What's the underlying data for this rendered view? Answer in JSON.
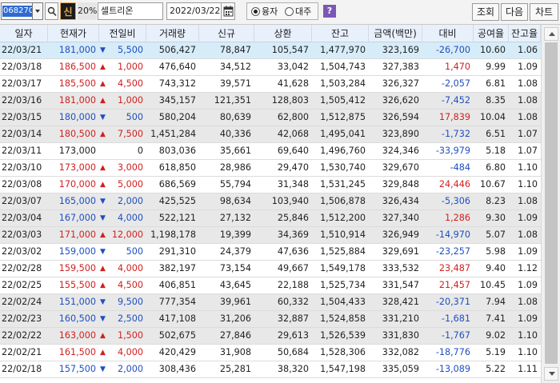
{
  "toolbar": {
    "code": "068270",
    "sin_label": "신",
    "pct_label": "20%",
    "stock_name": "셀트리온",
    "date": "2022/03/22",
    "radio_yongja": "융자",
    "radio_daeju": "대주",
    "help_label": "?",
    "btn_view": "조회",
    "btn_next": "다음",
    "btn_chart": "차트"
  },
  "columns": [
    "일자",
    "현재가",
    "전일비",
    "거래량",
    "신규",
    "상환",
    "잔고",
    "금액(백만)",
    "대비",
    "공여율",
    "잔고율"
  ],
  "colors": {
    "up": "#d21f1f",
    "down": "#1f4fbf",
    "selected_row": "#d7ecf9",
    "alt_row": "#e8e8e8",
    "header": "#e8f0fb"
  },
  "rows": [
    {
      "date": "22/03/21",
      "price": "181,000",
      "dir": "down",
      "chg": "5,500",
      "vol": "506,427",
      "new": "78,847",
      "repay": "105,547",
      "bal": "1,477,970",
      "amt": "323,169",
      "diff": "-26,700",
      "ddir": "down",
      "supply": "10.60",
      "balrate": "1.06",
      "style": "sel"
    },
    {
      "date": "22/03/18",
      "price": "186,500",
      "dir": "up",
      "chg": "1,000",
      "vol": "476,640",
      "new": "34,512",
      "repay": "33,042",
      "bal": "1,504,743",
      "amt": "327,383",
      "diff": "1,470",
      "ddir": "up",
      "supply": "9.99",
      "balrate": "1.09",
      "style": ""
    },
    {
      "date": "22/03/17",
      "price": "185,500",
      "dir": "up",
      "chg": "4,500",
      "vol": "743,312",
      "new": "39,571",
      "repay": "41,628",
      "bal": "1,503,284",
      "amt": "326,327",
      "diff": "-2,057",
      "ddir": "down",
      "supply": "6.81",
      "balrate": "1.08",
      "style": ""
    },
    {
      "date": "22/03/16",
      "price": "181,000",
      "dir": "up",
      "chg": "1,000",
      "vol": "345,157",
      "new": "121,351",
      "repay": "128,803",
      "bal": "1,505,412",
      "amt": "326,620",
      "diff": "-7,452",
      "ddir": "down",
      "supply": "8.35",
      "balrate": "1.08",
      "style": "alt"
    },
    {
      "date": "22/03/15",
      "price": "180,000",
      "dir": "down",
      "chg": "500",
      "vol": "580,204",
      "new": "80,639",
      "repay": "62,800",
      "bal": "1,512,875",
      "amt": "326,594",
      "diff": "17,839",
      "ddir": "up",
      "supply": "10.04",
      "balrate": "1.08",
      "style": "alt"
    },
    {
      "date": "22/03/14",
      "price": "180,500",
      "dir": "up",
      "chg": "7,500",
      "vol": "1,451,284",
      "new": "40,336",
      "repay": "42,068",
      "bal": "1,495,041",
      "amt": "323,890",
      "diff": "-1,732",
      "ddir": "down",
      "supply": "6.51",
      "balrate": "1.07",
      "style": "alt"
    },
    {
      "date": "22/03/11",
      "price": "173,000",
      "dir": "flat",
      "chg": "0",
      "vol": "803,036",
      "new": "35,661",
      "repay": "69,640",
      "bal": "1,496,760",
      "amt": "324,346",
      "diff": "-33,979",
      "ddir": "down",
      "supply": "5.18",
      "balrate": "1.07",
      "style": ""
    },
    {
      "date": "22/03/10",
      "price": "173,000",
      "dir": "up",
      "chg": "3,000",
      "vol": "618,850",
      "new": "28,986",
      "repay": "29,470",
      "bal": "1,530,740",
      "amt": "329,670",
      "diff": "-484",
      "ddir": "down",
      "supply": "6.80",
      "balrate": "1.10",
      "style": ""
    },
    {
      "date": "22/03/08",
      "price": "170,000",
      "dir": "up",
      "chg": "5,000",
      "vol": "686,569",
      "new": "55,794",
      "repay": "31,348",
      "bal": "1,531,245",
      "amt": "329,848",
      "diff": "24,446",
      "ddir": "up",
      "supply": "10.67",
      "balrate": "1.10",
      "style": ""
    },
    {
      "date": "22/03/07",
      "price": "165,000",
      "dir": "down",
      "chg": "2,000",
      "vol": "425,525",
      "new": "98,634",
      "repay": "103,940",
      "bal": "1,506,878",
      "amt": "326,434",
      "diff": "-5,306",
      "ddir": "down",
      "supply": "8.23",
      "balrate": "1.08",
      "style": "alt"
    },
    {
      "date": "22/03/04",
      "price": "167,000",
      "dir": "down",
      "chg": "4,000",
      "vol": "522,121",
      "new": "27,132",
      "repay": "25,846",
      "bal": "1,512,200",
      "amt": "327,340",
      "diff": "1,286",
      "ddir": "up",
      "supply": "9.30",
      "balrate": "1.09",
      "style": "alt"
    },
    {
      "date": "22/03/03",
      "price": "171,000",
      "dir": "up",
      "chg": "12,000",
      "vol": "1,198,178",
      "new": "19,399",
      "repay": "34,369",
      "bal": "1,510,914",
      "amt": "326,949",
      "diff": "-14,970",
      "ddir": "down",
      "supply": "5.07",
      "balrate": "1.08",
      "style": "alt"
    },
    {
      "date": "22/03/02",
      "price": "159,000",
      "dir": "down",
      "chg": "500",
      "vol": "291,310",
      "new": "24,379",
      "repay": "47,636",
      "bal": "1,525,884",
      "amt": "329,691",
      "diff": "-23,257",
      "ddir": "down",
      "supply": "5.98",
      "balrate": "1.09",
      "style": ""
    },
    {
      "date": "22/02/28",
      "price": "159,500",
      "dir": "up",
      "chg": "4,000",
      "vol": "382,197",
      "new": "73,154",
      "repay": "49,667",
      "bal": "1,549,178",
      "amt": "333,532",
      "diff": "23,487",
      "ddir": "up",
      "supply": "9.40",
      "balrate": "1.12",
      "style": ""
    },
    {
      "date": "22/02/25",
      "price": "155,500",
      "dir": "up",
      "chg": "4,500",
      "vol": "406,851",
      "new": "43,645",
      "repay": "22,188",
      "bal": "1,525,734",
      "amt": "331,547",
      "diff": "21,457",
      "ddir": "up",
      "supply": "10.45",
      "balrate": "1.09",
      "style": ""
    },
    {
      "date": "22/02/24",
      "price": "151,000",
      "dir": "down",
      "chg": "9,500",
      "vol": "777,354",
      "new": "39,961",
      "repay": "60,332",
      "bal": "1,504,433",
      "amt": "328,421",
      "diff": "-20,371",
      "ddir": "down",
      "supply": "7.94",
      "balrate": "1.08",
      "style": "alt"
    },
    {
      "date": "22/02/23",
      "price": "160,500",
      "dir": "down",
      "chg": "2,500",
      "vol": "417,108",
      "new": "31,206",
      "repay": "32,887",
      "bal": "1,524,858",
      "amt": "331,210",
      "diff": "-1,681",
      "ddir": "down",
      "supply": "7.41",
      "balrate": "1.09",
      "style": "alt"
    },
    {
      "date": "22/02/22",
      "price": "163,000",
      "dir": "up",
      "chg": "1,500",
      "vol": "502,675",
      "new": "27,846",
      "repay": "29,613",
      "bal": "1,526,539",
      "amt": "331,830",
      "diff": "-1,767",
      "ddir": "down",
      "supply": "9.02",
      "balrate": "1.10",
      "style": "alt"
    },
    {
      "date": "22/02/21",
      "price": "161,500",
      "dir": "up",
      "chg": "4,000",
      "vol": "420,429",
      "new": "31,908",
      "repay": "50,684",
      "bal": "1,528,306",
      "amt": "332,082",
      "diff": "-18,776",
      "ddir": "down",
      "supply": "5.19",
      "balrate": "1.10",
      "style": ""
    },
    {
      "date": "22/02/18",
      "price": "157,500",
      "dir": "down",
      "chg": "2,000",
      "vol": "308,436",
      "new": "25,281",
      "repay": "38,320",
      "bal": "1,547,198",
      "amt": "335,059",
      "diff": "-13,089",
      "ddir": "down",
      "supply": "5.22",
      "balrate": "1.11",
      "style": ""
    }
  ]
}
